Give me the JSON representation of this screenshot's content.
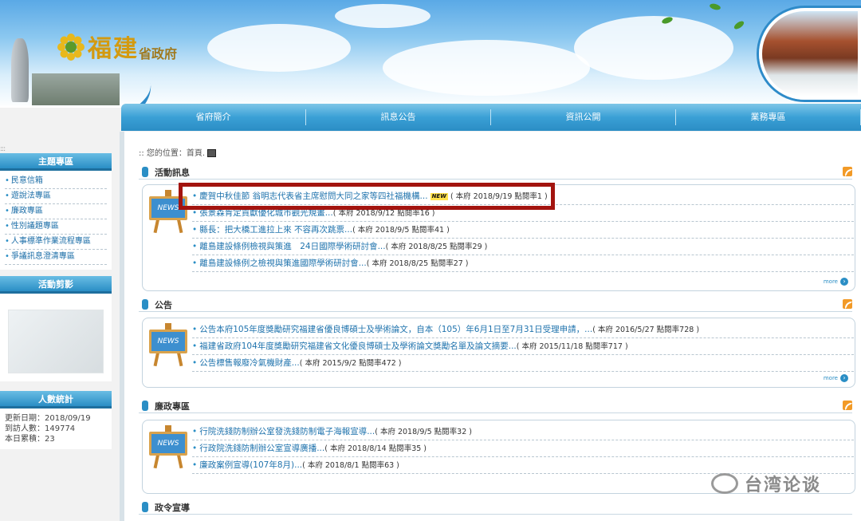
{
  "header": {
    "logo_text": "福建",
    "logo_sub": "省政府"
  },
  "nav": {
    "items": [
      "省府簡介",
      "訊息公告",
      "資訊公開",
      "業務專區"
    ]
  },
  "breadcrumb": ":: 您的位置：首頁.",
  "sidebar": {
    "topics_title": "主題專區",
    "topics": [
      "民意信箱",
      "遊說法專區",
      "廉政專區",
      "性別議題專區",
      "人事標準作業流程專區",
      "爭議訊息澄清專區"
    ],
    "photos_title": "活動剪影",
    "stats_title": "人數統計",
    "stats": [
      "更新日期：2018/09/19",
      "到訪人數：149774",
      "本日累積：23"
    ]
  },
  "sections": [
    {
      "title": "活動訊息",
      "items": [
        {
          "title": "慶賀中秋佳節 翁明志代表省主席慰問大同之家等四社福機構...",
          "new": "NEW",
          "meta": "( 本府 2018/9/19 點閱率1 )"
        },
        {
          "title": "張景森肯定貢獻優化城市觀光規畫...",
          "new": "",
          "meta": "( 本府 2018/9/12 點閱率16 )"
        },
        {
          "title": "縣長：把大橋工進拉上來 不容再次跳票...",
          "new": "",
          "meta": "( 本府 2018/9/5 點閱率41 )"
        },
        {
          "title": "離島建設條例檢視與策進　24日國際學術研討會...",
          "new": "",
          "meta": "( 本府 2018/8/25 點閱率29 )"
        },
        {
          "title": "離島建設條例之檢視與策進國際學術研討會...",
          "new": "",
          "meta": "( 本府 2018/8/25 點閱率27 )"
        }
      ]
    },
    {
      "title": "公告",
      "items": [
        {
          "title": "公告本府105年度獎勵研究福建省優良博碩士及學術論文，自本（105）年6月1日至7月31日受理申請，...",
          "new": "",
          "meta": "( 本府 2016/5/27 點閱率728 )"
        },
        {
          "title": "福建省政府104年度獎勵研究福建省文化優良博碩士及學術論文獎勵名單及論文摘要...",
          "new": "",
          "meta": "( 本府 2015/11/18 點閱率717 )"
        },
        {
          "title": "公告標售報廢冷氣機財產...",
          "new": "",
          "meta": "( 本府 2015/9/2 點閱率472 )"
        }
      ]
    },
    {
      "title": "廉政專區",
      "items": [
        {
          "title": "行院洗錢防制辦公室發洗錢防制電子海報宣導...",
          "new": "",
          "meta": "( 本府 2018/9/5 點閱率32 )"
        },
        {
          "title": "行政院洗錢防制辦公室宣導廣播...",
          "new": "",
          "meta": "( 本府 2018/8/14 點閱率35 )"
        },
        {
          "title": "廉政案例宣導(107年8月)...",
          "new": "",
          "meta": "( 本府 2018/8/1 點閱率63 )"
        }
      ]
    },
    {
      "title": "政令宣導",
      "items": []
    }
  ],
  "panel_badge": "NEWS",
  "more_label": "more",
  "watermark": "台湾论谈",
  "colors": {
    "accent": "#2a8ec5",
    "highlight": "#a3140f",
    "link": "#1f73ad"
  }
}
